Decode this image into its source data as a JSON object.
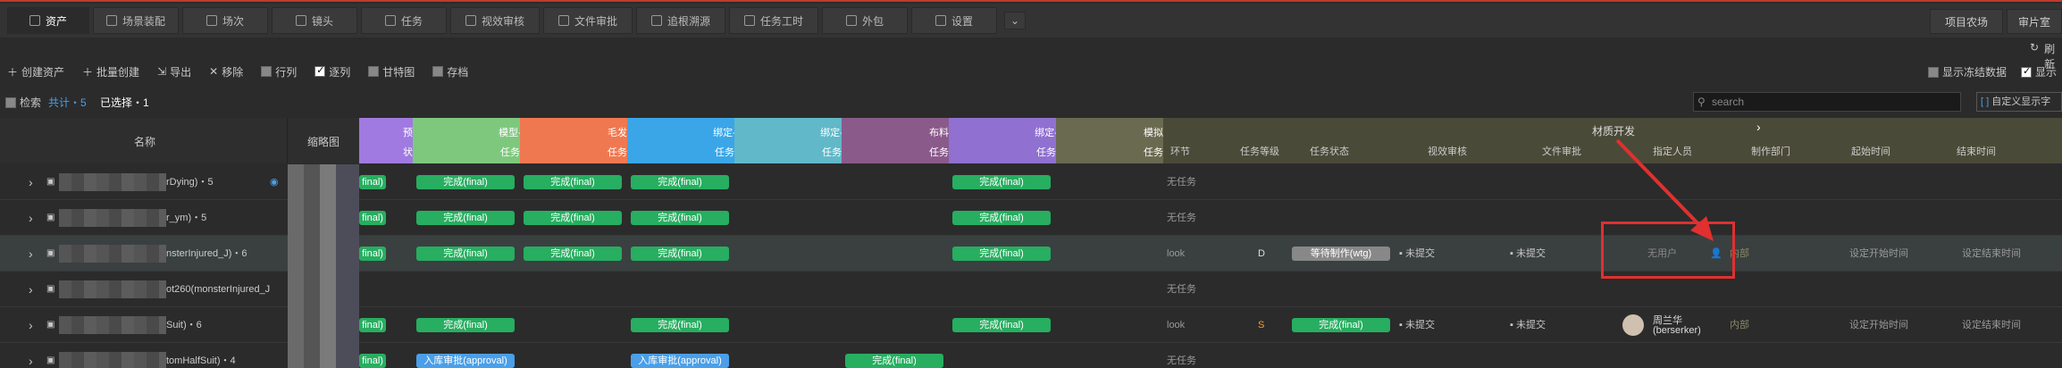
{
  "tabs": [
    "资产",
    "场景装配",
    "场次",
    "镜头",
    "任务",
    "视效审核",
    "文件审批",
    "追根溯源",
    "任务工时",
    "外包",
    "设置"
  ],
  "right_buttons": [
    "项目农场",
    "审片室"
  ],
  "refresh_label": "刷新",
  "toolbar": {
    "create": "创建资产",
    "batch": "批量创建",
    "export": "导出",
    "remove": "移除",
    "row": "行列",
    "column": "逐列",
    "gantt": "甘特图",
    "archive": "存档"
  },
  "toolbar_right": {
    "freeze": "显示冻结数据",
    "show": "显示"
  },
  "filter": {
    "search_label": "检索",
    "total": "共计・5",
    "selected": "已选择・1"
  },
  "search": {
    "placeholder": "search"
  },
  "custom_show": "自定义显示字",
  "headers": {
    "name": "名称",
    "thumb": "缩略图"
  },
  "pipeline": [
    {
      "t1": "预览",
      "t2": "状态",
      "color": "#a07ae0"
    },
    {
      "t1": "模型-材质",
      "t2": "任务状态",
      "color": "#7ec87e"
    },
    {
      "t1": "毛发塑形",
      "t2": "任务状态",
      "color": "#f07850"
    },
    {
      "t1": "绑定-预览",
      "t2": "任务状态",
      "color": "#3aa6e8"
    },
    {
      "t1": "绑定-渲染",
      "t2": "任务状态",
      "color": "#60b8c8"
    },
    {
      "t1": "布料绑定",
      "t2": "任务状态",
      "color": "#8a5a8a"
    },
    {
      "t1": "绑定-毛发",
      "t2": "任务状态",
      "color": "#9070d0"
    },
    {
      "t1": "模拟设置",
      "t2": "任务状态",
      "color": "#6a6a50"
    }
  ],
  "material_group": "材质开发",
  "detail_cols": [
    "环节",
    "任务等级",
    "任务状态",
    "视效审核",
    "文件审批",
    "指定人员",
    "制作部门",
    "起始时间",
    "结束时间"
  ],
  "rows": [
    {
      "name": "rDying)・5",
      "status": [
        "final)",
        "完成(final)",
        "完成(final)",
        "完成(final)",
        "",
        "",
        "完成(final)",
        ""
      ],
      "kinds": [
        "g",
        "g",
        "g",
        "g",
        "",
        "",
        "g",
        ""
      ],
      "link": "无任务"
    },
    {
      "name": "r_ym)・5",
      "status": [
        "final)",
        "完成(final)",
        "完成(final)",
        "完成(final)",
        "",
        "",
        "完成(final)",
        ""
      ],
      "kinds": [
        "g",
        "g",
        "g",
        "g",
        "",
        "",
        "g",
        ""
      ],
      "link": "无任务"
    },
    {
      "name": "nsterInjured_J)・6",
      "status": [
        "final)",
        "完成(final)",
        "完成(final)",
        "完成(final)",
        "",
        "",
        "完成(final)",
        ""
      ],
      "kinds": [
        "g",
        "g",
        "g",
        "g",
        "",
        "",
        "g",
        ""
      ],
      "link": "look",
      "level": "D",
      "task": "等待制作(wtg)",
      "vfx": "未提交",
      "file": "未提交",
      "person": "无用户",
      "dept": "内部",
      "start": "设定开始时间",
      "end": "设定结束时间"
    },
    {
      "name": "ot260(monsterInjured_J",
      "status": [
        "",
        "",
        "",
        "",
        "",
        "",
        "",
        ""
      ],
      "kinds": [
        "",
        "",
        "",
        "",
        "",
        "",
        "",
        ""
      ],
      "link": "无任务"
    },
    {
      "name": "Suit)・6",
      "status": [
        "final)",
        "完成(final)",
        "",
        "完成(final)",
        "",
        "",
        "完成(final)",
        ""
      ],
      "kinds": [
        "g",
        "g",
        "",
        "g",
        "",
        "",
        "g",
        ""
      ],
      "link": "look",
      "level": "S",
      "task": "完成(final)",
      "vfx": "未提交",
      "file": "未提交",
      "person": "周兰华",
      "person2": "(berserker)",
      "dept": "内部",
      "start": "设定开始时间",
      "end": "设定结束时间"
    },
    {
      "name": "tomHalfSuit)・4",
      "status": [
        "final)",
        "入库审批(approval)",
        "",
        "入库审批(approval)",
        "",
        "完成(final)",
        "",
        ""
      ],
      "kinds": [
        "g",
        "b",
        "",
        "b",
        "",
        "g",
        "",
        ""
      ],
      "link": "无任务"
    }
  ]
}
